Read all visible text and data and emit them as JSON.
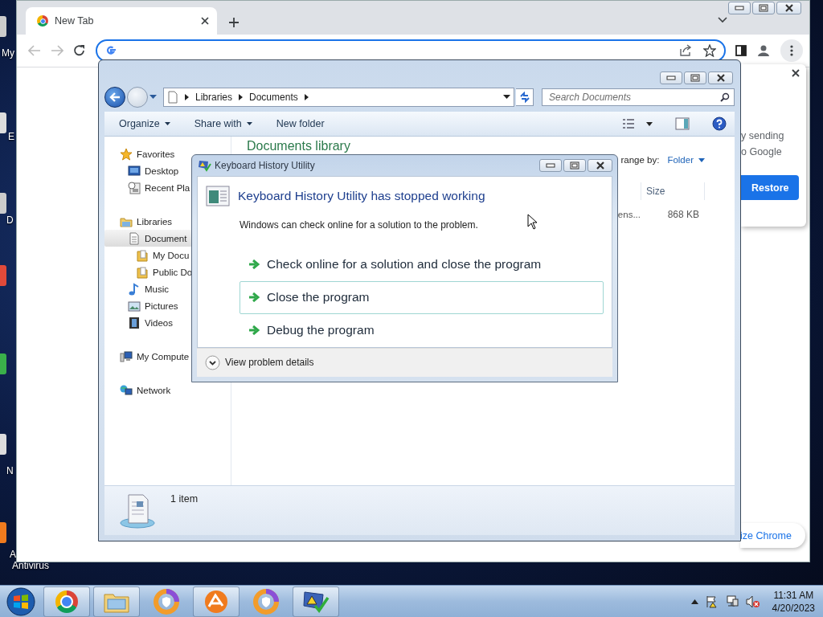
{
  "desktop": {
    "icon_labels": [
      "My",
      "E",
      "D",
      "N",
      "A",
      "Antivirus"
    ]
  },
  "browser": {
    "tab": {
      "title": "New Tab",
      "selected": true
    },
    "restore_card": {
      "lines": [
        "y sending",
        "o Google"
      ],
      "button": "Restore"
    },
    "customize_button": "ize Chrome"
  },
  "explorer": {
    "breadcrumb": [
      "Libraries",
      "Documents"
    ],
    "search": {
      "placeholder": "Search Documents"
    },
    "toolbar": [
      {
        "label": "Organize",
        "has_menu": true
      },
      {
        "label": "Share with",
        "has_menu": true
      },
      {
        "label": "New folder",
        "has_menu": false
      }
    ],
    "nav": [
      {
        "label": "Favorites",
        "kind": "star",
        "selected": false,
        "children": [
          {
            "label": "Desktop",
            "kind": "desktop",
            "selected": false
          },
          {
            "label": "Recent Pla",
            "kind": "recent",
            "selected": false
          }
        ]
      },
      {
        "label": "Libraries",
        "kind": "library",
        "selected": false,
        "children": [
          {
            "label": "Document",
            "kind": "document",
            "selected": true,
            "children": [
              {
                "label": "My Docu",
                "kind": "folder",
                "selected": false
              },
              {
                "label": "Public Do",
                "kind": "folder",
                "selected": false
              }
            ]
          },
          {
            "label": "Music",
            "kind": "music",
            "selected": false
          },
          {
            "label": "Pictures",
            "kind": "pictures",
            "selected": false
          },
          {
            "label": "Videos",
            "kind": "videos",
            "selected": false
          }
        ]
      },
      {
        "label": "My Compute",
        "kind": "computer",
        "selected": false
      },
      {
        "label": "Network",
        "kind": "network",
        "selected": false
      }
    ],
    "library_title": "Documents library",
    "arrange_label": "range by:",
    "arrange_value": "Folder",
    "columns": [
      "Size"
    ],
    "rows": [
      {
        "cells": [
          "ens...",
          "868 KB"
        ]
      }
    ],
    "status": "1 item"
  },
  "dialog": {
    "title": "Keyboard History Utility",
    "heading": "Keyboard History Utility has stopped working",
    "message": "Windows can check online for a solution to the problem.",
    "options": [
      {
        "label": "Check online for a solution and close the program",
        "selected": false
      },
      {
        "label": "Close the program",
        "selected": true
      },
      {
        "label": "Debug the program",
        "selected": false
      }
    ],
    "details_toggle": "View problem details"
  },
  "taskbar": {
    "apps": [
      {
        "kind": "chrome",
        "open": true
      },
      {
        "kind": "explorer",
        "open": true
      },
      {
        "kind": "ring",
        "open": false
      },
      {
        "kind": "avast",
        "open": true
      },
      {
        "kind": "ring",
        "open": false
      },
      {
        "kind": "utility",
        "open": true
      }
    ],
    "clock": {
      "time": "11:31 AM",
      "date": "4/20/2023"
    }
  }
}
